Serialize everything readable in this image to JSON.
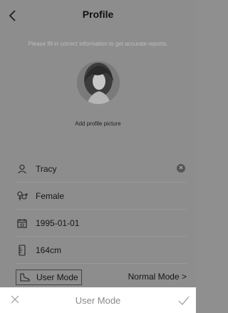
{
  "header": {
    "title": "Profile",
    "back_icon": "chevron-left-icon"
  },
  "hint": "Please fill in correct information to get accurate reports.",
  "avatar": {
    "caption": "Add profile picture"
  },
  "fields": {
    "name": {
      "value": "Tracy",
      "icon": "user-icon",
      "clear_icon": "clear-icon"
    },
    "gender": {
      "value": "Female",
      "icon": "gender-icon"
    },
    "birthday": {
      "value": "1995-01-01",
      "icon": "calendar-icon"
    },
    "height": {
      "value": "164cm",
      "icon": "ruler-icon"
    }
  },
  "mode": {
    "label": "User Mode",
    "value": "Normal Mode >",
    "icon": "shoe-icon"
  },
  "picker": {
    "title": "User Mode",
    "cancel_icon": "close-icon",
    "confirm_icon": "check-icon"
  },
  "colors": {
    "overlay": "#8d8d8d",
    "sheet": "#ffffff",
    "text": "#161616"
  }
}
